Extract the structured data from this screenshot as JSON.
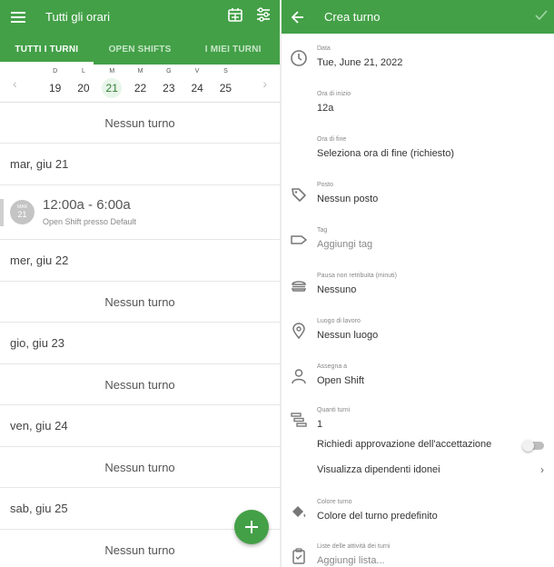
{
  "left": {
    "title": "Tutti gli orari",
    "tabs": [
      {
        "label": "TUTTI I TURNI"
      },
      {
        "label": "OPEN SHIFTS"
      },
      {
        "label": "I MIEI TURNI"
      }
    ],
    "week": [
      {
        "letter": "D",
        "num": "19"
      },
      {
        "letter": "L",
        "num": "20"
      },
      {
        "letter": "M",
        "num": "21"
      },
      {
        "letter": "M",
        "num": "22"
      },
      {
        "letter": "G",
        "num": "23"
      },
      {
        "letter": "V",
        "num": "24"
      },
      {
        "letter": "S",
        "num": "25"
      }
    ],
    "empty_label": "Nessun turno",
    "dates": [
      "mar, giu 21",
      "mer, giu 22",
      "gio, giu 23",
      "ven, giu 24",
      "sab, giu 25"
    ],
    "shift": {
      "avatar_top": "MAR",
      "avatar_num": "21",
      "time": "12:00a - 6:00a",
      "sub": "Open Shift presso Default"
    }
  },
  "right": {
    "title": "Crea turno",
    "fields": {
      "data": {
        "label": "Data",
        "value": "Tue, June 21, 2022"
      },
      "inizio": {
        "label": "Ora di inizio",
        "value": "12a"
      },
      "fine": {
        "label": "Ora di fine",
        "value": "Seleziona ora di fine (richiesto)"
      },
      "posto": {
        "label": "Posto",
        "value": "Nessun posto"
      },
      "tag": {
        "label": "Tag",
        "value": "Aggiungi tag"
      },
      "pausa": {
        "label": "Pausa non retribuita (minuti)",
        "value": "Nessuno"
      },
      "luogo": {
        "label": "Luogo di lavoro",
        "value": "Nessun luogo"
      },
      "assegna": {
        "label": "Assegna a",
        "value": "Open Shift"
      },
      "quanti": {
        "label": "Quanti turni",
        "value": "1"
      },
      "colore": {
        "label": "Colore turno",
        "value": "Colore del turno predefinito"
      },
      "liste": {
        "label": "Liste delle attività dei turni",
        "value": "Aggiungi lista..."
      }
    },
    "approval_label": "Richiedi approvazione dell'accettazione",
    "eligible_label": "Visualizza dipendenti idonei"
  }
}
